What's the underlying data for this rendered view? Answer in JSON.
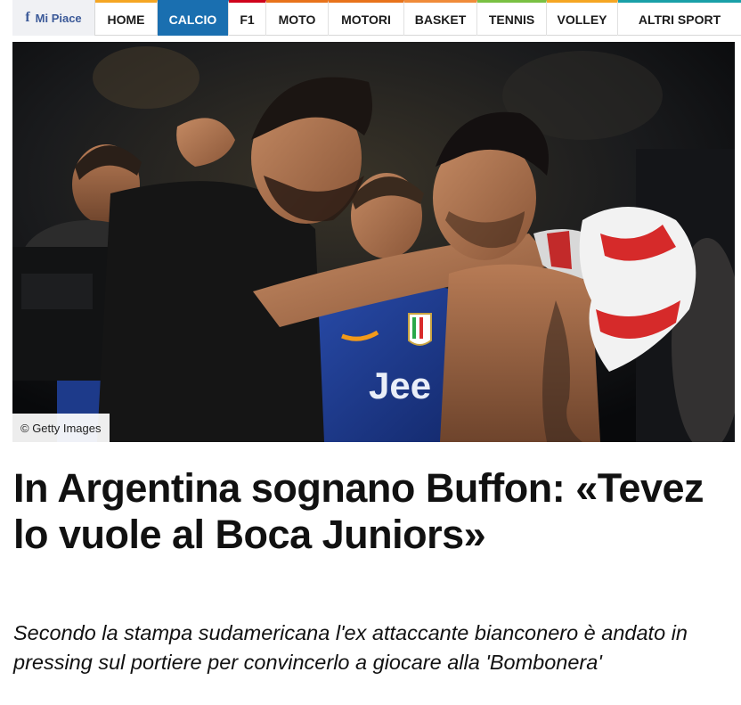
{
  "nav": {
    "like_label": "Mi Piace",
    "like_icon": "facebook-icon",
    "items": [
      {
        "label": "HOME",
        "accent": "#f5a623",
        "active": false
      },
      {
        "label": "CALCIO",
        "accent": "#1a6fb0",
        "active": true
      },
      {
        "label": "F1",
        "accent": "#d0021b",
        "active": false
      },
      {
        "label": "MOTO",
        "accent": "#e8731b",
        "active": false
      },
      {
        "label": "MOTORI",
        "accent": "#e8731b",
        "active": false
      },
      {
        "label": "BASKET",
        "accent": "#f08c3a",
        "active": false
      },
      {
        "label": "TENNIS",
        "accent": "#7ac143",
        "active": false
      },
      {
        "label": "VOLLEY",
        "accent": "#f5a623",
        "active": false
      },
      {
        "label": "ALTRI SPORT",
        "accent": "#1aa0a8",
        "active": false
      }
    ]
  },
  "hero": {
    "credit": "© Getty Images",
    "jersey_text": "Jee"
  },
  "article": {
    "title": "In Argentina sognano Buffon: «Tevez lo vuole al Boca Juniors»",
    "subtitle": "Secondo la stampa sudamericana l'ex attaccante bianconero è andato in pressing sul portiere per convincerlo a giocare alla 'Bombonera'"
  },
  "colors": {
    "active_nav_bg": "#1a6fb0",
    "facebook_blue": "#3b5998"
  }
}
